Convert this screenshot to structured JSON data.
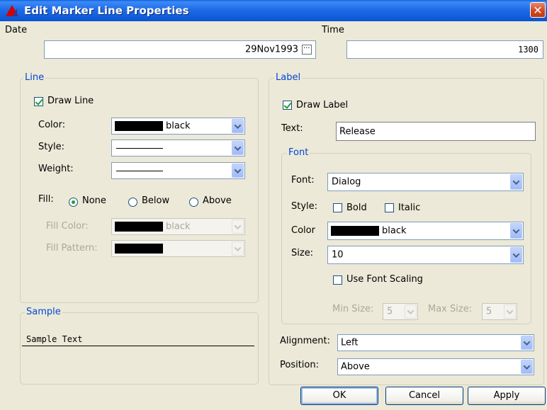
{
  "window": {
    "title": "Edit Marker Line Properties",
    "close": "✕"
  },
  "date": {
    "label": "Date",
    "value": "29Nov1993"
  },
  "time": {
    "label": "Time",
    "value": "1300"
  },
  "line": {
    "title": "Line",
    "draw_line": {
      "label": "Draw Line",
      "checked": true
    },
    "color": {
      "label": "Color:",
      "value": "black"
    },
    "style": {
      "label": "Style:"
    },
    "weight": {
      "label": "Weight:"
    },
    "fill": {
      "label": "Fill:",
      "options": [
        "None",
        "Below",
        "Above"
      ],
      "selected": "None"
    },
    "fill_color": {
      "label": "Fill Color:",
      "value": "black"
    },
    "fill_pattern": {
      "label": "Fill Pattern:"
    }
  },
  "sample": {
    "title": "Sample",
    "text": "Sample Text"
  },
  "label": {
    "title": "Label",
    "draw_label": {
      "label": "Draw Label",
      "checked": true
    },
    "text": {
      "label": "Text:",
      "value": "Release"
    },
    "alignment": {
      "label": "Alignment:",
      "value": "Left"
    },
    "position": {
      "label": "Position:",
      "value": "Above"
    }
  },
  "font": {
    "title": "Font",
    "font": {
      "label": "Font:",
      "value": "Dialog"
    },
    "style": {
      "label": "Style:",
      "bold": "Bold",
      "italic": "Italic"
    },
    "color": {
      "label": "Color",
      "value": "black"
    },
    "size": {
      "label": "Size:",
      "value": "10"
    },
    "use_scaling": {
      "label": "Use Font Scaling",
      "checked": false
    },
    "min_size": {
      "label": "Min Size:",
      "value": "5"
    },
    "max_size": {
      "label": "Max Size:",
      "value": "5"
    }
  },
  "buttons": {
    "ok": "OK",
    "cancel": "Cancel",
    "apply": "Apply"
  },
  "colors": {
    "title_bar": "#1f6ce8",
    "group_title": "#0046d5",
    "dialog_bg": "#ece9d8",
    "check": "#21a121"
  }
}
